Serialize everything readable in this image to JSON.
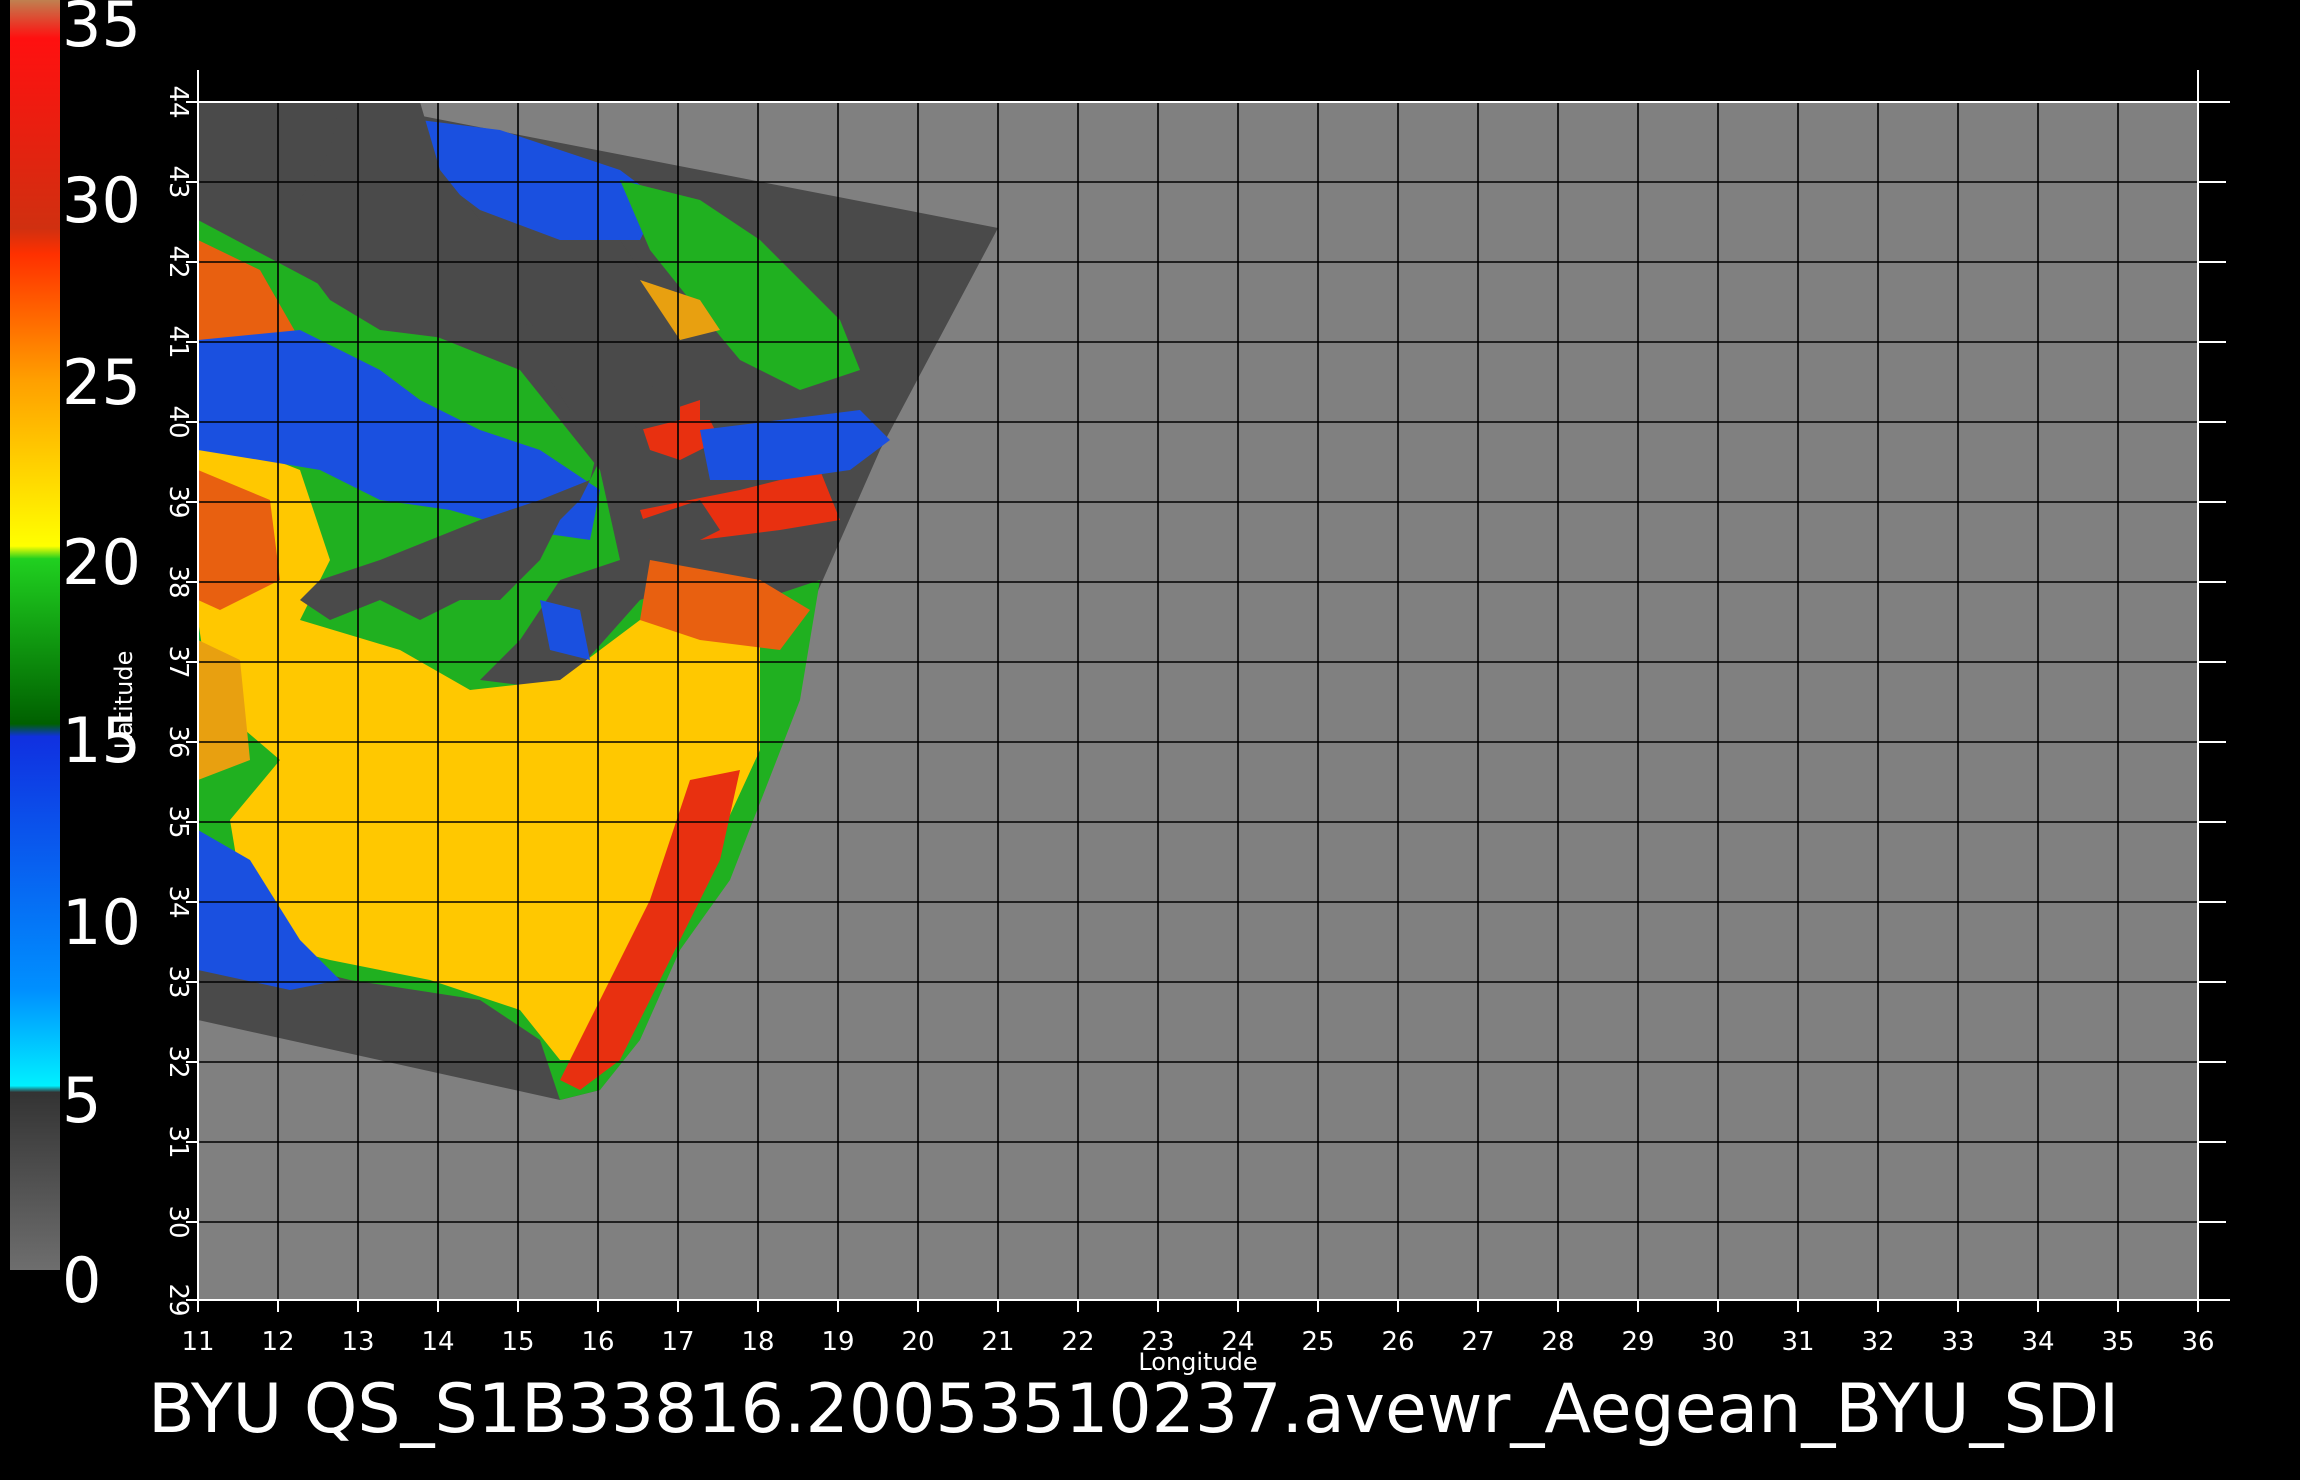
{
  "colorbar": {
    "labels": [
      "35",
      "30",
      "25",
      "20",
      "15",
      "10",
      "5",
      "0"
    ]
  },
  "axes": {
    "xlabel": "Longitude",
    "ylabel": "Latitude",
    "lon_range": [
      11,
      36
    ],
    "lat_range": [
      29,
      44
    ],
    "x_ticks": [
      "11",
      "12",
      "13",
      "14",
      "15",
      "16",
      "17",
      "18",
      "19",
      "20",
      "21",
      "22",
      "23",
      "24",
      "25",
      "26",
      "27",
      "28",
      "29",
      "30",
      "31",
      "32",
      "33",
      "34",
      "35",
      "36"
    ],
    "y_ticks": [
      "29",
      "30",
      "31",
      "32",
      "33",
      "34",
      "35",
      "36",
      "37",
      "38",
      "39",
      "40",
      "41",
      "42",
      "43",
      "44"
    ],
    "grid": true
  },
  "caption": "BYU  QS_S1B33816.20053510237.avewr_Aegean_BYU_SDI",
  "colors": {
    "background": "#000000",
    "map_fill": "#808080",
    "swath_fill": "#4a4a4a",
    "grid": "#000000",
    "low_wind": "#1a50e0",
    "mid_wind": "#20b020",
    "high_wind": "#ffc800",
    "max_wind": "#e83010"
  }
}
